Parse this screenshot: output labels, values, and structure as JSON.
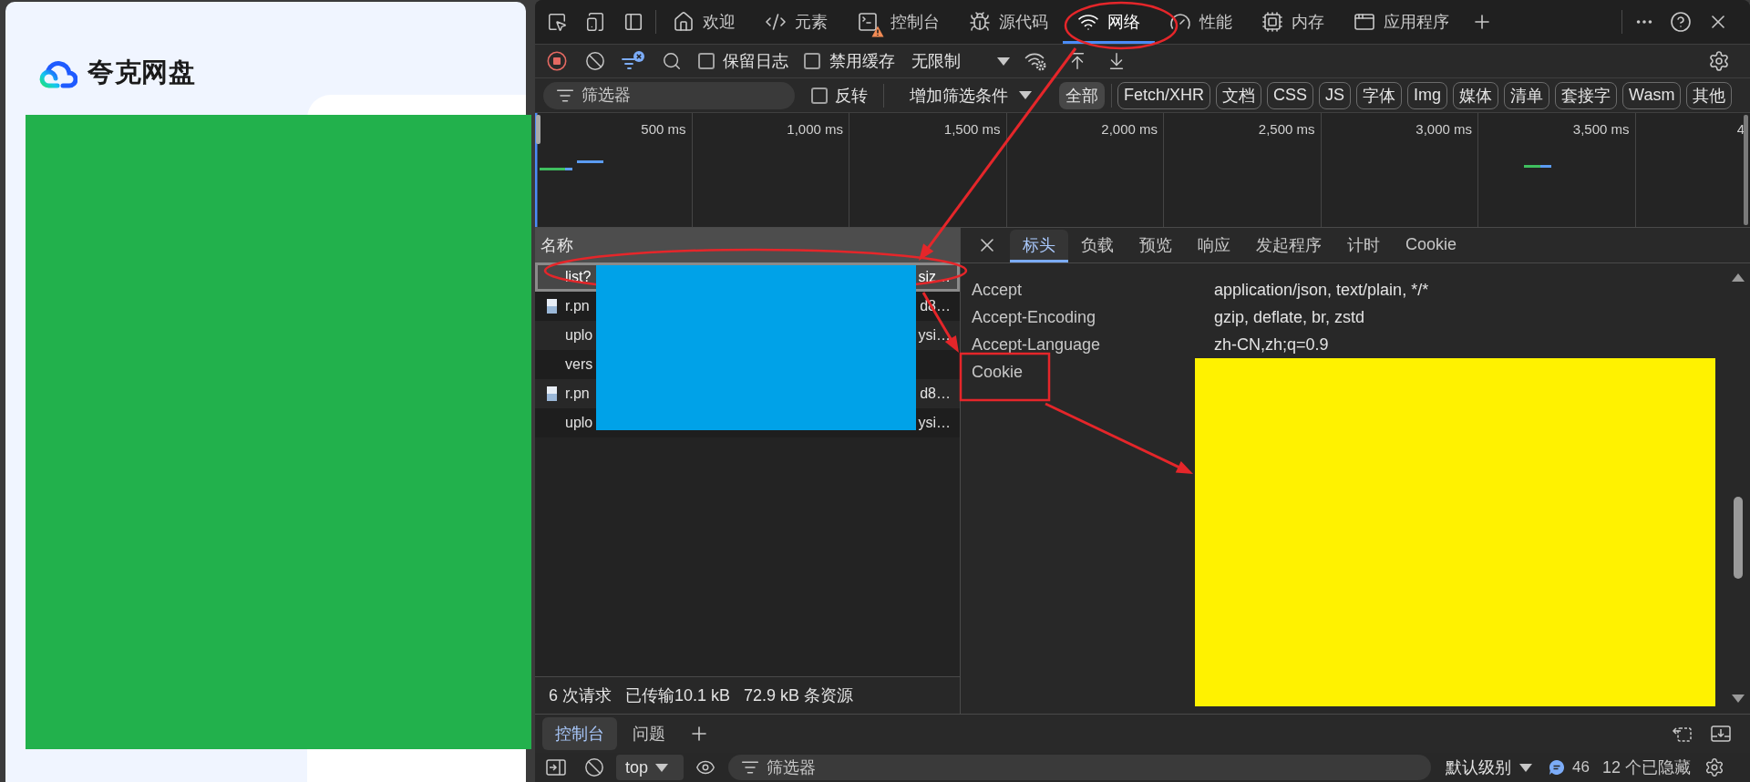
{
  "page": {
    "logo": {
      "text": "夸克网盘"
    }
  },
  "devtools": {
    "panel_tabs": [
      {
        "label": "欢迎",
        "selected": false,
        "warning": false
      },
      {
        "label": "元素",
        "selected": false,
        "warning": false
      },
      {
        "label": "控制台",
        "selected": false,
        "warning": true
      },
      {
        "label": "源代码",
        "selected": false,
        "warning": false
      },
      {
        "label": "网络",
        "selected": true,
        "warning": false
      },
      {
        "label": "性能",
        "selected": false,
        "warning": false
      },
      {
        "label": "内存",
        "selected": false,
        "warning": false
      },
      {
        "label": "应用程序",
        "selected": false,
        "warning": false
      }
    ],
    "toolbar": {
      "recording": true,
      "preserve_log": {
        "label": "保留日志",
        "checked": false
      },
      "disable_cache": {
        "label": "禁用缓存",
        "checked": false
      },
      "throttling": "无限制"
    },
    "filter_bar": {
      "placeholder": "筛选器",
      "invert": {
        "label": "反转",
        "checked": false
      },
      "more_filters": "增加筛选条件",
      "types": [
        {
          "label": "全部",
          "selected": true
        },
        {
          "label": "Fetch/XHR",
          "selected": false
        },
        {
          "label": "文档",
          "selected": false
        },
        {
          "label": "CSS",
          "selected": false
        },
        {
          "label": "JS",
          "selected": false
        },
        {
          "label": "字体",
          "selected": false
        },
        {
          "label": "Img",
          "selected": false
        },
        {
          "label": "媒体",
          "selected": false
        },
        {
          "label": "清单",
          "selected": false
        },
        {
          "label": "套接字",
          "selected": false
        },
        {
          "label": "Wasm",
          "selected": false
        },
        {
          "label": "其他",
          "selected": false
        }
      ]
    },
    "timeline": {
      "ticks": [
        "500 ms",
        "1,000 ms",
        "1,500 ms",
        "2,000 ms",
        "2,500 ms",
        "3,000 ms",
        "3,500 ms",
        "4"
      ]
    },
    "requests": {
      "column": "名称",
      "rows": [
        {
          "kind": "data",
          "name_start": "list?",
          "name_end": "siz…",
          "selected": true
        },
        {
          "kind": "image",
          "name_start": "r.pn",
          "name_end": "d8…",
          "selected": false
        },
        {
          "kind": "data",
          "name_start": "uplo",
          "name_end": "ysi…",
          "selected": false
        },
        {
          "kind": "data",
          "name_start": "vers",
          "selected": false
        },
        {
          "kind": "image",
          "name_start": "r.pn",
          "name_end": "d8…",
          "selected": false
        },
        {
          "kind": "data",
          "name_start": "uplo",
          "name_end": "ysi…",
          "selected": false
        }
      ]
    },
    "summary": [
      "6 次请求",
      "已传输10.1 kB",
      "72.9 kB 条资源"
    ],
    "detail": {
      "tabs": [
        {
          "label": "标头",
          "selected": true
        },
        {
          "label": "负载",
          "selected": false
        },
        {
          "label": "预览",
          "selected": false
        },
        {
          "label": "响应",
          "selected": false
        },
        {
          "label": "发起程序",
          "selected": false
        },
        {
          "label": "计时",
          "selected": false
        },
        {
          "label": "Cookie",
          "selected": false
        }
      ],
      "headers": [
        {
          "name": "Accept",
          "value": "application/json, text/plain, */*"
        },
        {
          "name": "Accept-Encoding",
          "value": "gzip, deflate, br, zstd"
        },
        {
          "name": "Accept-Language",
          "value": "zh-CN,zh;q=0.9"
        },
        {
          "name": "Cookie"
        }
      ]
    },
    "drawer": {
      "tabs": [
        {
          "label": "控制台",
          "selected": true
        },
        {
          "label": "问题",
          "selected": false
        }
      ],
      "context": "top",
      "filter_placeholder": "筛选器",
      "level": "默认级别",
      "message_count": "46",
      "hidden_count": "12 个已隐藏"
    }
  }
}
